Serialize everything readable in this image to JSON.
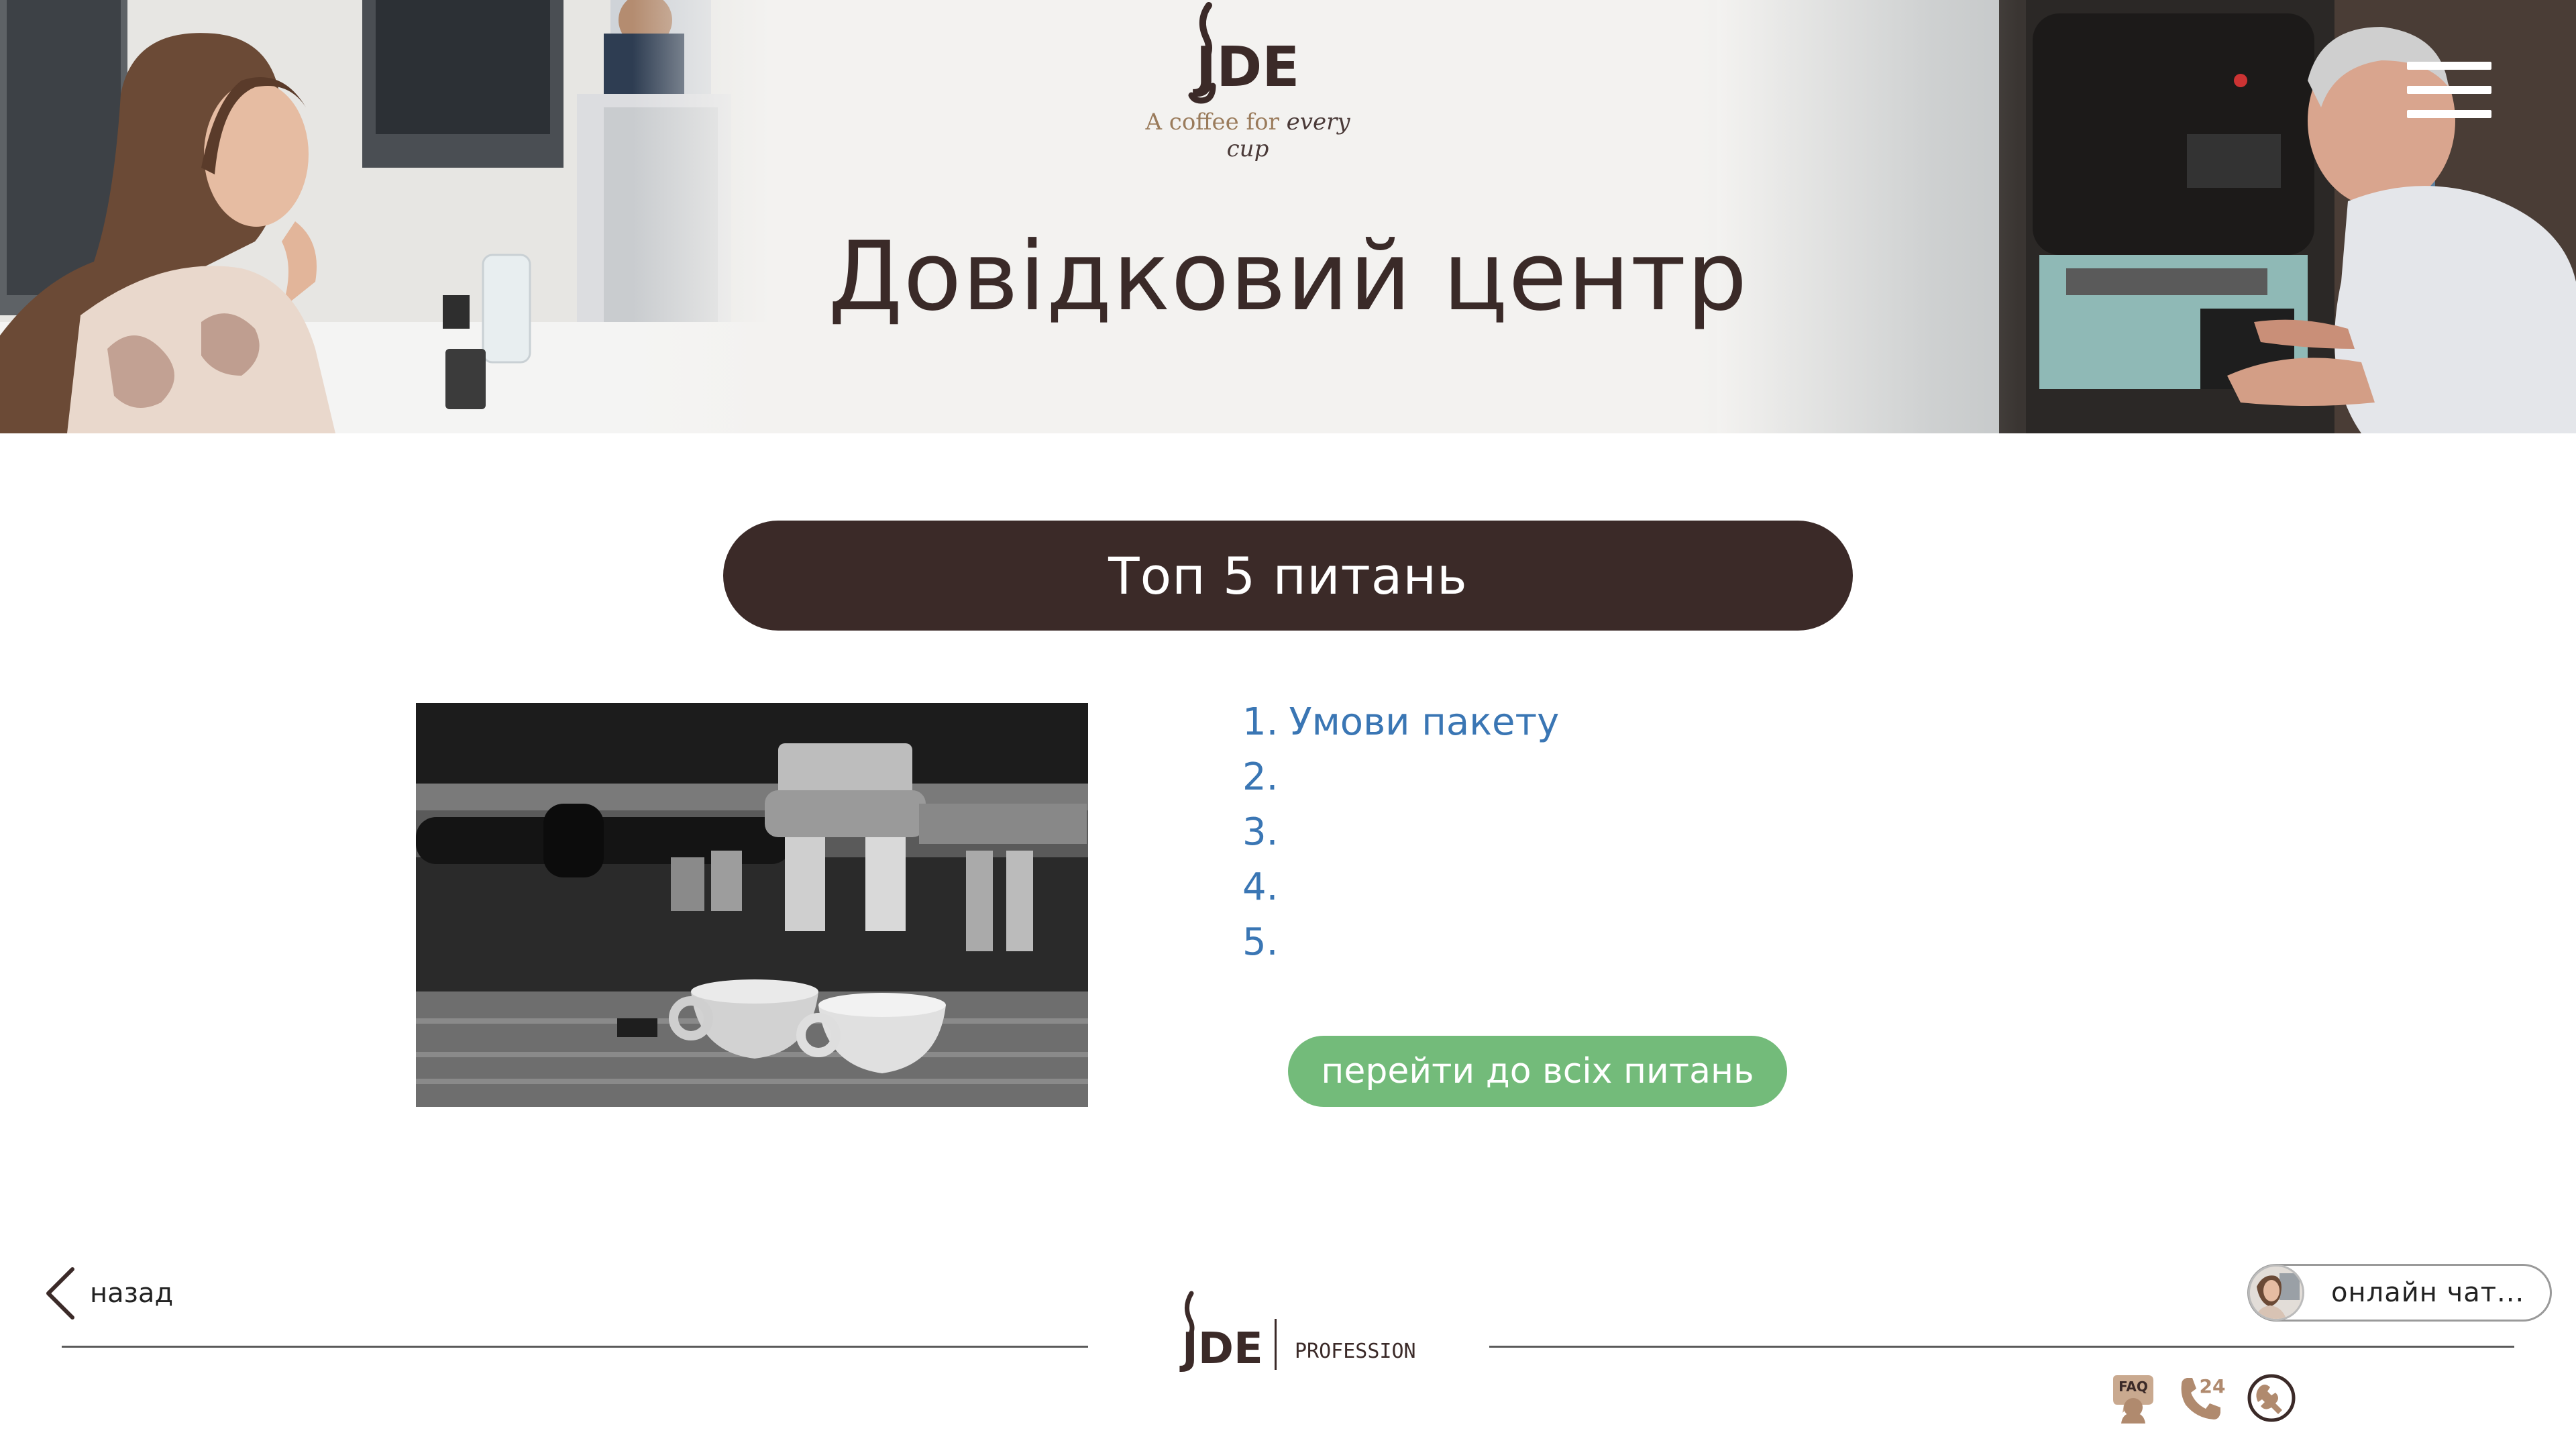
{
  "hero": {
    "brand": "JDE",
    "tagline_plain": "A coffee for ",
    "tagline_emph": "every cup",
    "title": "Довідковий центр"
  },
  "top_questions": {
    "heading": "Топ 5 питань",
    "items": [
      {
        "num": "1.",
        "text": "Умови пакету"
      },
      {
        "num": "2.",
        "text": ""
      },
      {
        "num": "3.",
        "text": ""
      },
      {
        "num": "4.",
        "text": ""
      },
      {
        "num": "5.",
        "text": ""
      }
    ],
    "all_button": "перейти до всіх питань"
  },
  "footer": {
    "back_label": "назад",
    "brand": "JDE",
    "brand_sub": "PROFESSIONAL",
    "chat_label": "онлайн чат...",
    "icons": {
      "faq_label": "FAQ",
      "support_label": "24"
    }
  },
  "colors": {
    "dark_brown": "#3b2a28",
    "link_blue": "#3a76b4",
    "green_button": "#73bb7a"
  }
}
